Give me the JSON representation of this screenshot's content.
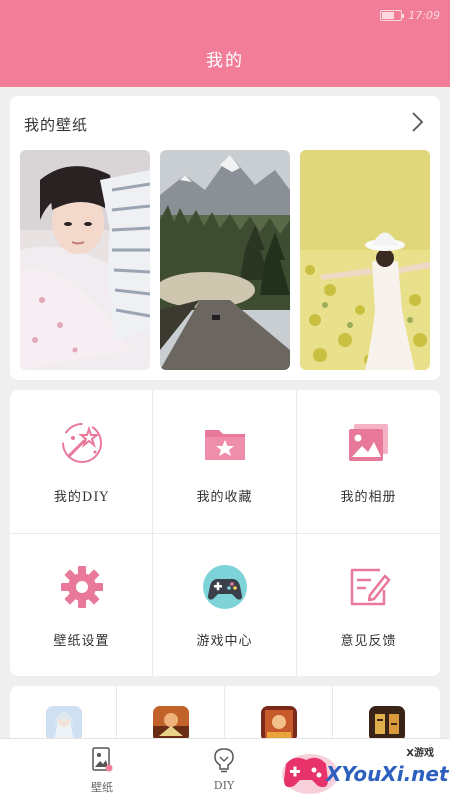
{
  "status_bar": {
    "time": "17:09"
  },
  "header": {
    "title": "我的"
  },
  "wallpapers": {
    "title": "我的壁纸",
    "items": [
      "girl-lying-on-pillow",
      "mountain-forest-road",
      "girl-in-flower-field"
    ]
  },
  "grid": {
    "items": [
      {
        "label": "我的DIY",
        "icon": "magic-wand-icon"
      },
      {
        "label": "我的收藏",
        "icon": "star-folder-icon"
      },
      {
        "label": "我的相册",
        "icon": "photo-album-icon"
      },
      {
        "label": "壁纸设置",
        "icon": "gear-icon"
      },
      {
        "label": "游戏中心",
        "icon": "gamepad-icon"
      },
      {
        "label": "意见反馈",
        "icon": "feedback-edit-icon"
      }
    ]
  },
  "tabs": [
    {
      "label": "壁纸",
      "icon": "wallpaper-tab-icon"
    },
    {
      "label": "DIY",
      "icon": "diy-tab-icon"
    }
  ],
  "watermark": {
    "text": "XYouXi.net",
    "sub": "X游戏"
  },
  "colors": {
    "accent": "#f27d99",
    "icon_pink": "#e9799a",
    "background": "#efefef"
  }
}
